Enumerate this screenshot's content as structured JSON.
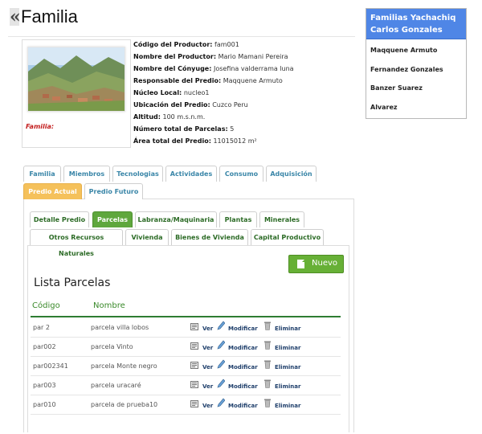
{
  "header": {
    "back_symbol": "«",
    "title": "Familia"
  },
  "families": {
    "selected_line1": "Familias Yachachiq",
    "selected_line2": "Carlos Gonzales",
    "items": [
      "Maqquene Armuto",
      "Fernandez Gonzales",
      "Banzer Suarez",
      "Alvarez"
    ]
  },
  "producer": {
    "photo_caption": "Familia:",
    "fields": [
      {
        "label": "Código del Productor:",
        "value": "fam001"
      },
      {
        "label": "Nombre del Productor:",
        "value": "Mario Mamani Pereira"
      },
      {
        "label": "Nombre del Cónyuge:",
        "value": "Josefina valderrama luna"
      },
      {
        "label": "Responsable del Predio:",
        "value": "Maqquene Armuto"
      },
      {
        "label": "Núcleo Local:",
        "value": "nucleo1"
      },
      {
        "label": "Ubicación del Predio:",
        "value": "Cuzco Peru"
      },
      {
        "label": "Altitud:",
        "value": "100 m.s.n.m."
      },
      {
        "label": "Número total de Parcelas:",
        "value": "5"
      },
      {
        "label": "Área total del Predio:",
        "value": "11015012 m²"
      }
    ]
  },
  "main_tabs": {
    "row1": [
      "Familia",
      "Miembros",
      "Tecnologias",
      "Actividades",
      "Consumo",
      "Adquisición"
    ],
    "row2": [
      "Predio Actual",
      "Predio Futuro"
    ]
  },
  "sub_tabs": {
    "row1": [
      "Detalle Predio",
      "Parcelas",
      "Labranza/Maquinaria",
      "Plantas",
      "Minerales"
    ],
    "row2": [
      "Otros Recursos Naturales",
      "Vivienda",
      "Bienes de Vivienda",
      "Capital Productivo"
    ]
  },
  "parcelas": {
    "new_button": "Nuevo",
    "title": "Lista Parcelas",
    "columns": [
      "Código",
      "Nombre"
    ],
    "actions": {
      "view": "Ver",
      "edit": "Modificar",
      "delete": "Eliminar"
    },
    "rows": [
      {
        "code": "par 2",
        "name": "parcela villa lobos"
      },
      {
        "code": "par002",
        "name": "parcela Vinto"
      },
      {
        "code": "par002341",
        "name": "parcela Monte negro"
      },
      {
        "code": "par003",
        "name": "parcela uracaré"
      },
      {
        "code": "par010",
        "name": "parcela de prueba10"
      }
    ]
  },
  "colors": {
    "family_header": "#4f86e6",
    "tab_active": "#f5c15b",
    "subtab_active": "#5fa73d",
    "new_button": "#67b036",
    "table_accent": "#2e7d32",
    "caption_red": "#c31f1f"
  }
}
